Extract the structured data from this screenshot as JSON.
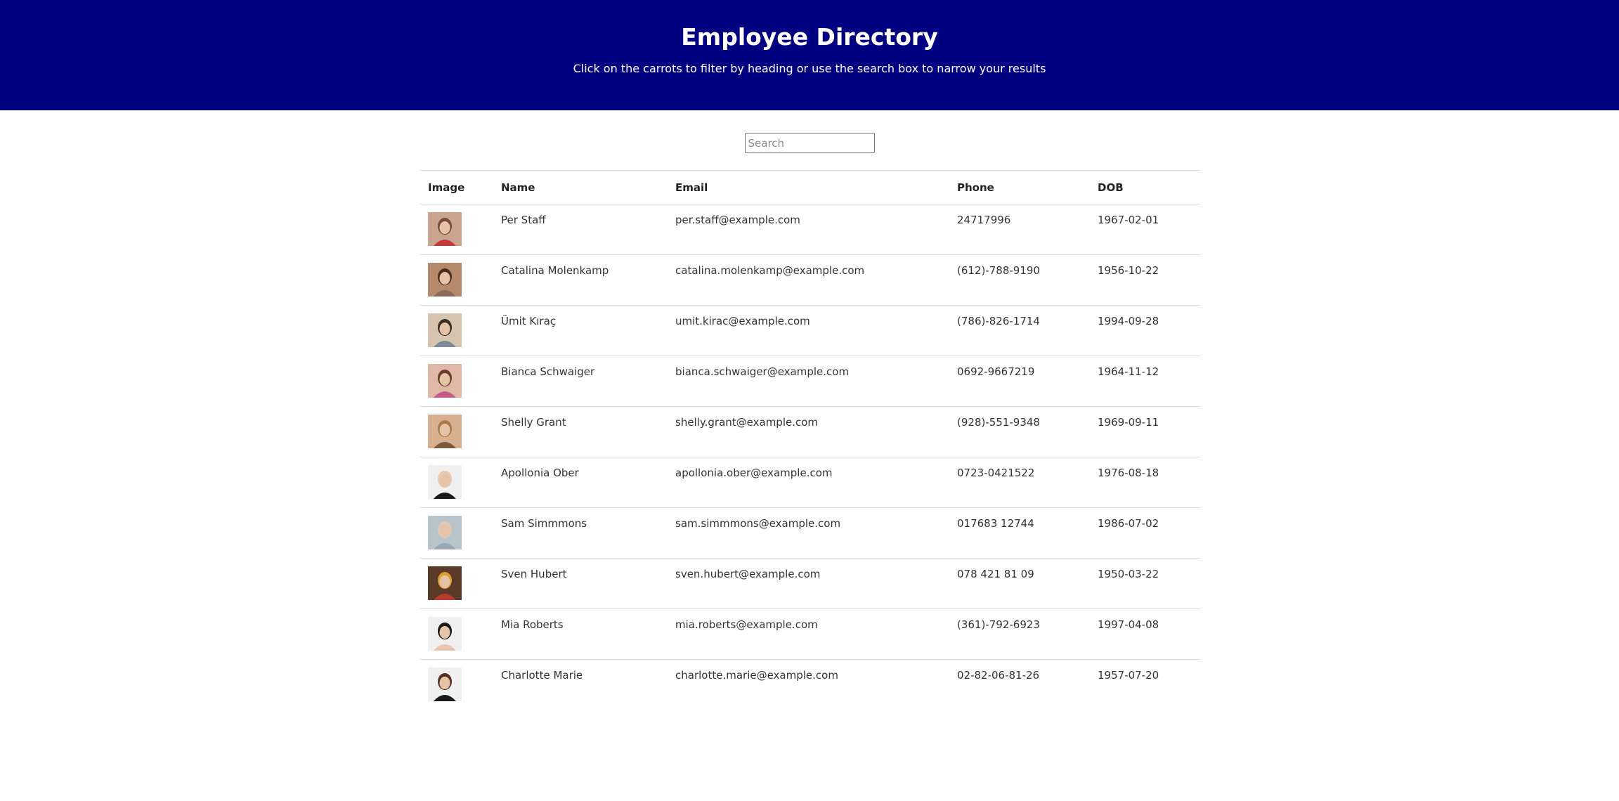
{
  "header": {
    "title": "Employee Directory",
    "subtitle": "Click on the carrots to filter by heading or use the search box to narrow your results",
    "background": "#000080"
  },
  "search": {
    "placeholder": "Search",
    "value": ""
  },
  "table": {
    "columns": [
      "Image",
      "Name",
      "Email",
      "Phone",
      "DOB"
    ],
    "rows": [
      {
        "name": "Per Staff",
        "email": "per.staff@example.com",
        "phone": "24717996",
        "dob": "1967-02-01",
        "avatar": "avatar-icon"
      },
      {
        "name": "Catalina Molenkamp",
        "email": "catalina.molenkamp@example.com",
        "phone": "(612)-788-9190",
        "dob": "1956-10-22",
        "avatar": "avatar-icon"
      },
      {
        "name": "Ümit Kıraç",
        "email": "umit.kirac@example.com",
        "phone": "(786)-826-1714",
        "dob": "1994-09-28",
        "avatar": "avatar-icon"
      },
      {
        "name": "Bianca Schwaiger",
        "email": "bianca.schwaiger@example.com",
        "phone": "0692-9667219",
        "dob": "1964-11-12",
        "avatar": "avatar-icon"
      },
      {
        "name": "Shelly Grant",
        "email": "shelly.grant@example.com",
        "phone": "(928)-551-9348",
        "dob": "1969-09-11",
        "avatar": "avatar-icon"
      },
      {
        "name": "Apollonia Ober",
        "email": "apollonia.ober@example.com",
        "phone": "0723-0421522",
        "dob": "1976-08-18",
        "avatar": "avatar-icon"
      },
      {
        "name": "Sam Simmmons",
        "email": "sam.simmmons@example.com",
        "phone": "017683 12744",
        "dob": "1986-07-02",
        "avatar": "avatar-icon"
      },
      {
        "name": "Sven Hubert",
        "email": "sven.hubert@example.com",
        "phone": "078 421 81 09",
        "dob": "1950-03-22",
        "avatar": "avatar-icon"
      },
      {
        "name": "Mia Roberts",
        "email": "mia.roberts@example.com",
        "phone": "(361)-792-6923",
        "dob": "1997-04-08",
        "avatar": "avatar-icon"
      },
      {
        "name": "Charlotte Marie",
        "email": "charlotte.marie@example.com",
        "phone": "02-82-06-81-26",
        "dob": "1957-07-20",
        "avatar": "avatar-icon"
      }
    ]
  }
}
